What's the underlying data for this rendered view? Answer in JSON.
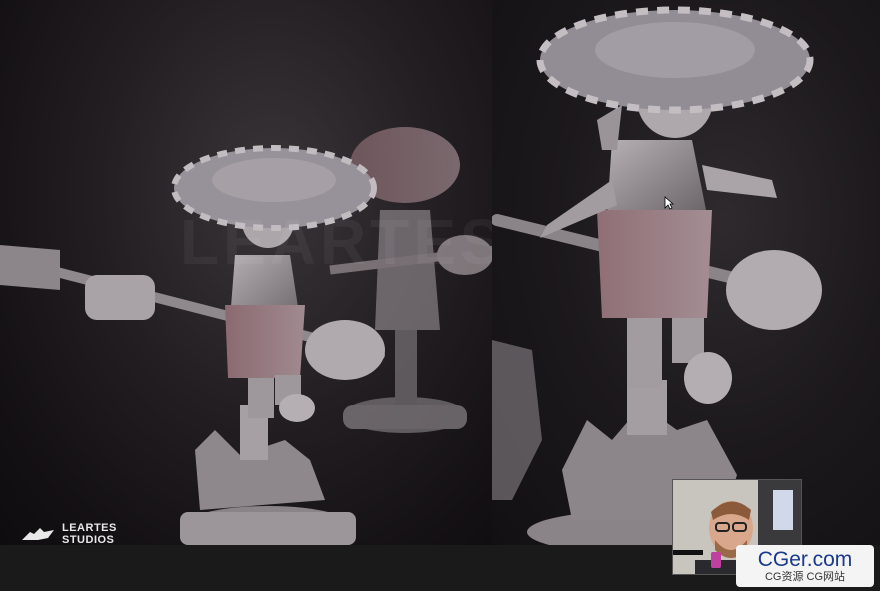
{
  "logo": {
    "line1": "LEARTES",
    "line2": "STUDIOS"
  },
  "watermark": {
    "text": "LEARTES STUDIOS"
  },
  "badge": {
    "main": "CGer.com",
    "sub": "CG资源 CG网站"
  },
  "colors": {
    "figure": "#9a9498",
    "background": "#1e1a1e",
    "badge_text": "#1a3a8c"
  }
}
